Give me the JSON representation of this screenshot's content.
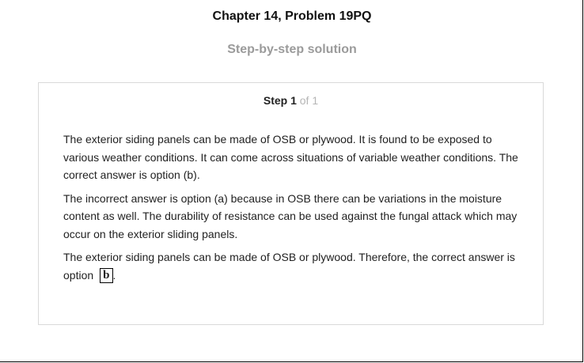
{
  "header": {
    "title": "Chapter 14, Problem 19PQ",
    "subtitle": "Step-by-step solution"
  },
  "step": {
    "label": "Step 1",
    "of_label": "of 1"
  },
  "solution": {
    "paragraph1": "The exterior siding panels can be made of OSB or plywood. It is found to be exposed to various weather conditions. It can come across situations of variable weather conditions. The correct answer is option (b).",
    "paragraph2": "The incorrect answer is option (a) because in OSB there can be variations in the moisture content as well. The durability of resistance can be used against the fungal attack which may occur on the exterior sliding panels.",
    "paragraph3_text": "The exterior siding panels can be made of OSB or plywood. Therefore, the correct answer is option",
    "answer": "b",
    "trailing": "."
  },
  "colors": {
    "subtitle": "#9b9b9b",
    "step_of": "#b5b5b5",
    "card_border": "#d9d9d9"
  }
}
